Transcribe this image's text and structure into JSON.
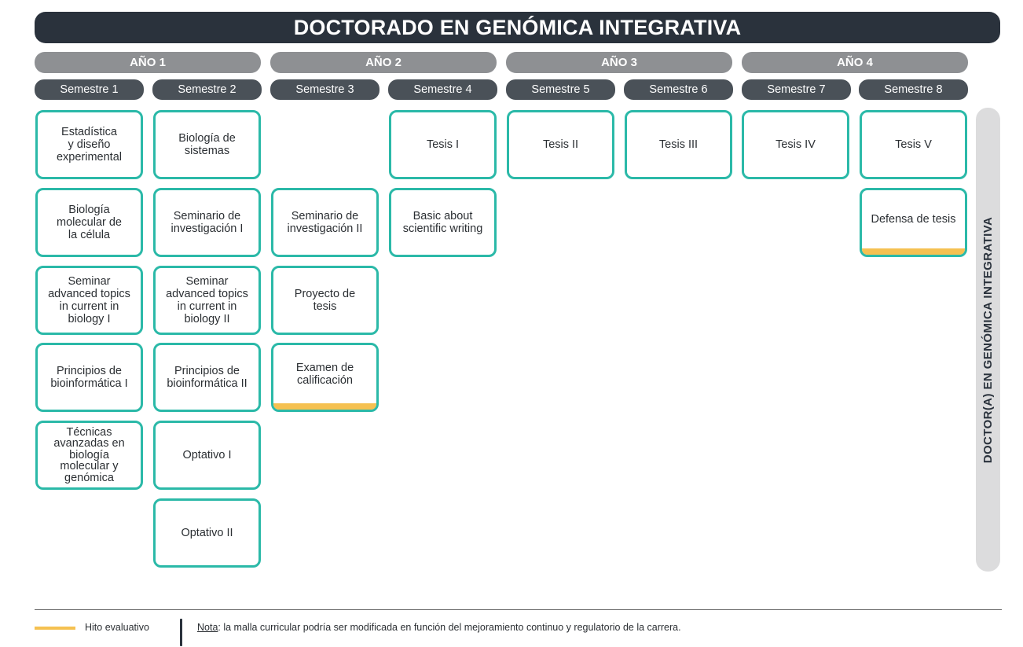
{
  "title": "DOCTORADO EN GENÓMICA INTEGRATIVA",
  "years": [
    "AÑO 1",
    "AÑO 2",
    "AÑO 3",
    "AÑO 4"
  ],
  "semesters": [
    "Semestre 1",
    "Semestre 2",
    "Semestre 3",
    "Semestre 4",
    "Semestre 5",
    "Semestre 6",
    "Semestre 7",
    "Semestre 8"
  ],
  "courses": {
    "s1": [
      "Estadística\ny diseño\nexperimental",
      "Biología\nmolecular de\nla célula",
      "Seminar\nadvanced topics\nin current in\nbiology I",
      "Principios de\nbioinformática I",
      "Técnicas\navanzadas en\nbiología\nmolecular y\ngenómica"
    ],
    "s2": [
      "Biología de\nsistemas",
      "Seminario de\ninvestigación I",
      "Seminar\nadvanced topics\nin current in\nbiology II",
      "Principios de\nbioinformática II",
      "Optativo I",
      "Optativo II"
    ],
    "s3": [
      "Seminario de\ninvestigación II",
      "Proyecto de\ntesis",
      "Examen de\ncalificación"
    ],
    "s4": [
      "Tesis I",
      "Basic about\nscientific writing"
    ],
    "s5": [
      "Tesis II"
    ],
    "s6": [
      "Tesis III"
    ],
    "s7": [
      "Tesis IV"
    ],
    "s8": [
      "Tesis V",
      "Defensa de tesis"
    ]
  },
  "degree": "DOCTOR(A) EN GENÓMICA INTEGRATIVA",
  "legend": {
    "hito_label": "Hito evaluativo"
  },
  "note": {
    "label": "Nota",
    "text": ": la malla curricular podría ser modificada en función del mejoramiento continuo y regulatorio de la carrera."
  },
  "colors": {
    "header_bg": "#2a323c",
    "year_bg": "#8e9093",
    "semester_bg": "#4a5158",
    "card_border": "#2bb9a8",
    "hito": "#f5c151"
  }
}
